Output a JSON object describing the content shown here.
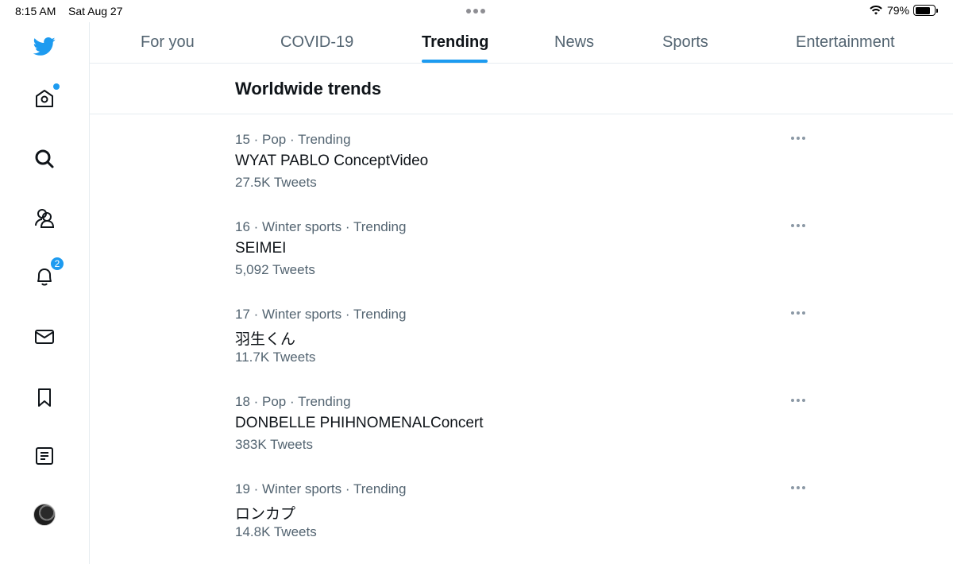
{
  "status_bar": {
    "time": "8:15 AM",
    "date": "Sat Aug 27",
    "battery_percent": "79%",
    "battery_level": 0.79,
    "wifi_icon": "wifi-icon"
  },
  "sidebar": {
    "items": [
      {
        "name": "twitter-logo-icon",
        "label": "Twitter"
      },
      {
        "name": "home-icon",
        "label": "Home",
        "has_dot": true
      },
      {
        "name": "search-icon",
        "label": "Explore"
      },
      {
        "name": "communities-icon",
        "label": "Communities"
      },
      {
        "name": "notifications-icon",
        "label": "Notifications",
        "badge": "2"
      },
      {
        "name": "messages-icon",
        "label": "Messages"
      },
      {
        "name": "bookmarks-icon",
        "label": "Bookmarks"
      },
      {
        "name": "lists-icon",
        "label": "Lists"
      },
      {
        "name": "profile-avatar",
        "label": "Profile"
      }
    ],
    "notification_badge": "2"
  },
  "tabs": [
    {
      "label": "For you",
      "active": false
    },
    {
      "label": "COVID-19",
      "active": false
    },
    {
      "label": "Trending",
      "active": true
    },
    {
      "label": "News",
      "active": false
    },
    {
      "label": "Sports",
      "active": false
    },
    {
      "label": "Entertainment",
      "active": false
    }
  ],
  "section": {
    "title": "Worldwide trends"
  },
  "trends": [
    {
      "rank": "15",
      "meta": "15 · Pop · Trending",
      "name": "WYAT PABLO ConceptVideo",
      "count": "27.5K Tweets"
    },
    {
      "rank": "16",
      "meta": "16 · Winter sports · Trending",
      "name": "SEIMEI",
      "count": "5,092 Tweets"
    },
    {
      "rank": "17",
      "meta": "17 · Winter sports · Trending",
      "name": "羽生くん",
      "count": "11.7K Tweets"
    },
    {
      "rank": "18",
      "meta": "18 · Pop · Trending",
      "name": "DONBELLE PHIHNOMENALConcert",
      "count": "383K Tweets"
    },
    {
      "rank": "19",
      "meta": "19 · Winter sports · Trending",
      "name": "ロンカプ",
      "count": "14.8K Tweets"
    }
  ],
  "colors": {
    "accent": "#1d9bf0",
    "text_primary": "#0f1419",
    "text_secondary": "#536471",
    "divider": "#e6ecf0"
  }
}
